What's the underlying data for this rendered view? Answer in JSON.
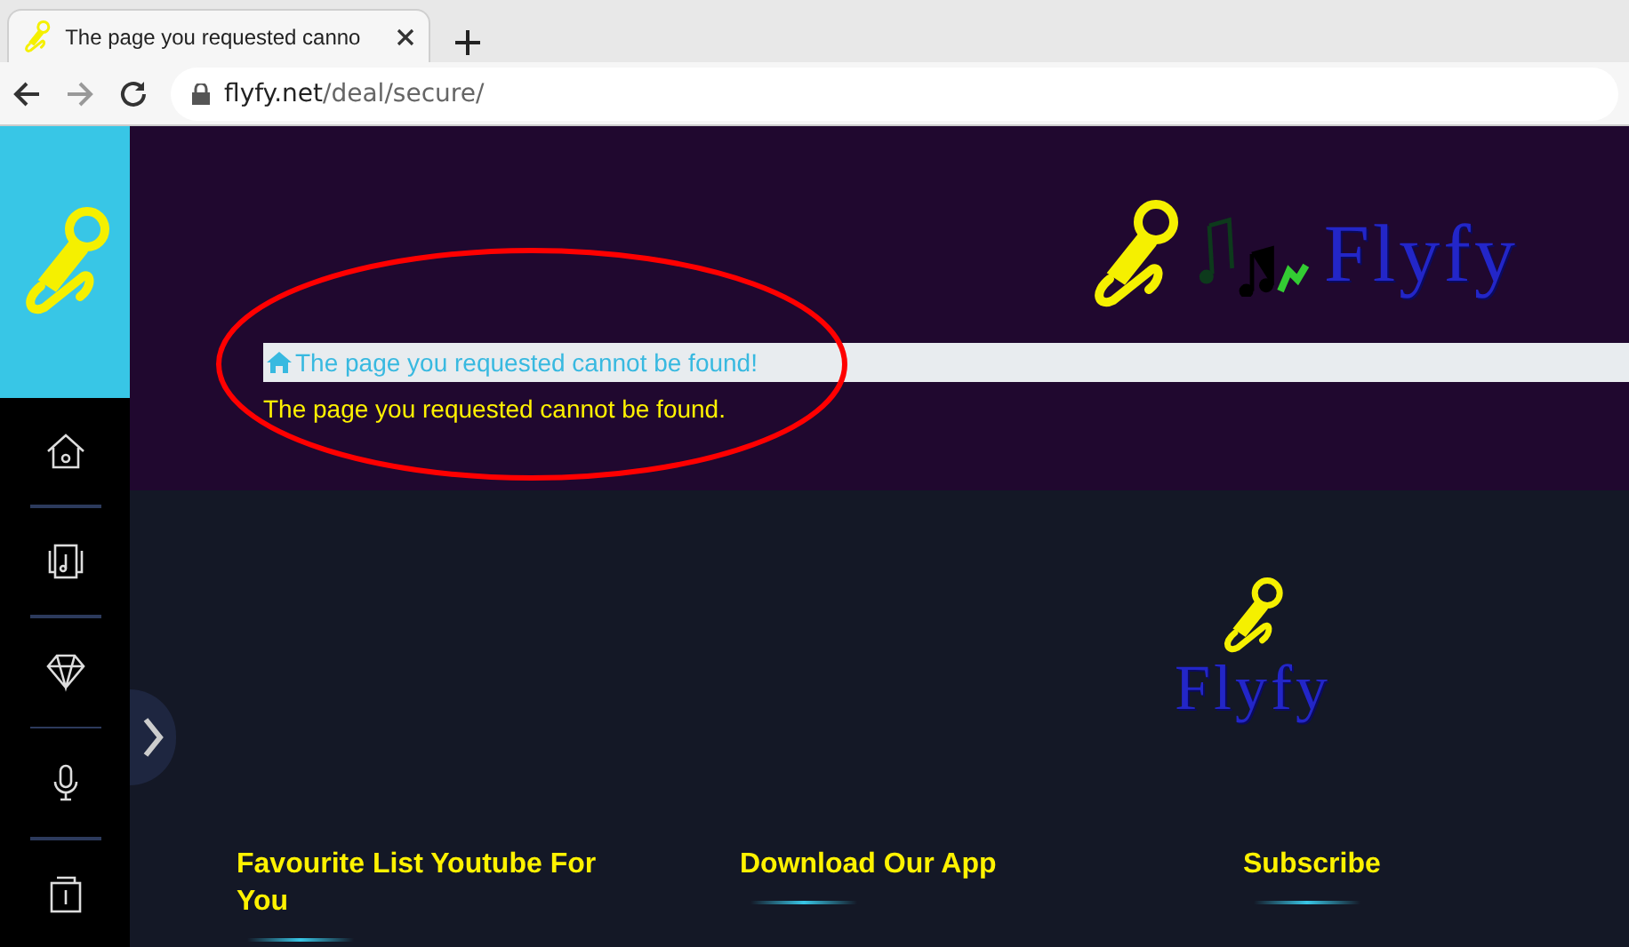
{
  "browser": {
    "tab_title": "The page you requested canno",
    "url_host": "flyfy.net",
    "url_path": "/deal/secure/"
  },
  "sidebar": {
    "items": [
      {
        "kind": "home"
      },
      {
        "kind": "music"
      },
      {
        "kind": "diamond"
      },
      {
        "kind": "mic"
      },
      {
        "kind": "box"
      }
    ]
  },
  "header": {
    "logo_text": "Flyfy",
    "breadcrumb": "The page you requested cannot be found!",
    "message": "The page you requested cannot be found."
  },
  "footer": {
    "logo_text": "Flyfy",
    "columns": [
      {
        "title": "Favourite List Youtube For You"
      },
      {
        "title": "Download Our App"
      },
      {
        "title": "Subscribe"
      }
    ]
  }
}
